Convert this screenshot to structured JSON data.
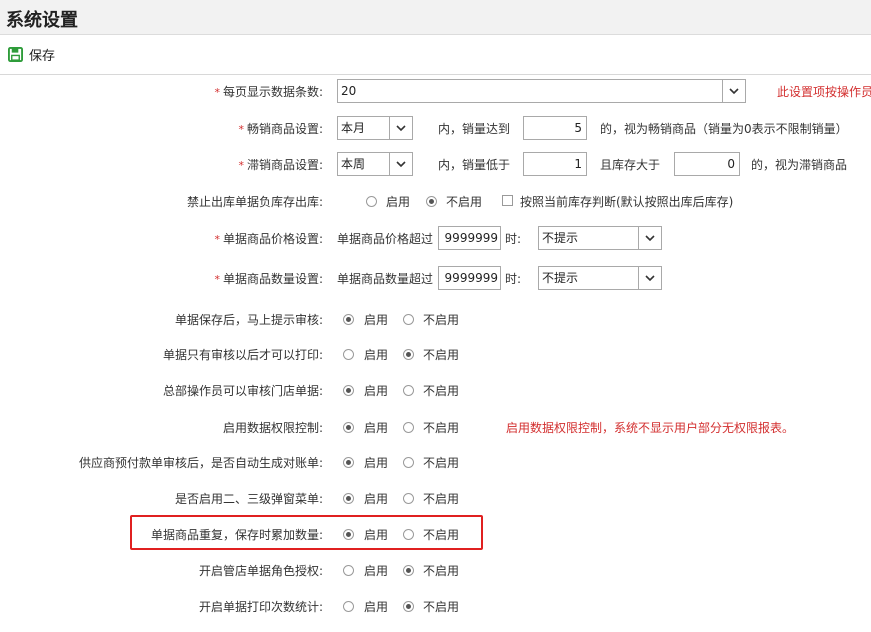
{
  "header": {
    "title": "系统设置"
  },
  "toolbar": {
    "save_label": "保存"
  },
  "common": {
    "enable": "启用",
    "disable": "不启用"
  },
  "settings": {
    "page_size": {
      "label": "每页显示数据条数:",
      "value": "20",
      "note": "此设置项按操作员"
    },
    "hot_items": {
      "label": "畅销商品设置:",
      "period": "本月",
      "text1": "内，销量达到",
      "threshold": "5",
      "text2": "的，视为畅销商品（销量为0表示不限制销量）"
    },
    "slow_items": {
      "label": "滞销商品设置:",
      "period": "本周",
      "text1": "内，销量低于",
      "threshold": "1",
      "text2": "且库存大于",
      "stock": "0",
      "text3": "的，视为滞销商品"
    },
    "negative_stock": {
      "label": "禁止出库单据负库存出库:",
      "checkbox_label": "按照当前库存判断(默认按照出库后库存)",
      "selected": "disable"
    },
    "price_limit": {
      "label": "单据商品价格设置:",
      "prefix": "单据商品价格超过",
      "value": "9999999",
      "suffix": "时:",
      "action": "不提示"
    },
    "qty_limit": {
      "label": "单据商品数量设置:",
      "prefix": "单据商品数量超过",
      "value": "9999999",
      "suffix": "时:",
      "action": "不提示"
    },
    "radio_rows": [
      {
        "label": "单据保存后，马上提示审核:",
        "selected": "enable"
      },
      {
        "label": "单据只有审核以后才可以打印:",
        "selected": "disable"
      },
      {
        "label": "总部操作员可以审核门店单据:",
        "selected": "enable"
      },
      {
        "label": "启用数据权限控制:",
        "selected": "enable",
        "note": "启用数据权限控制，系统不显示用户部分无权限报表。"
      },
      {
        "label": "供应商预付款单审核后，是否自动生成对账单:",
        "selected": "enable"
      },
      {
        "label": "是否启用二、三级弹窗菜单:",
        "selected": "enable"
      },
      {
        "label": "单据商品重复，保存时累加数量:",
        "selected": "enable"
      },
      {
        "label": "开启管店单据角色授权:",
        "selected": "disable"
      },
      {
        "label": "开启单据打印次数统计:",
        "selected": "disable"
      }
    ]
  },
  "colors": {
    "required": "#d32f2f",
    "highlight": "#e02020",
    "save_icon": "#2e9c3a"
  }
}
